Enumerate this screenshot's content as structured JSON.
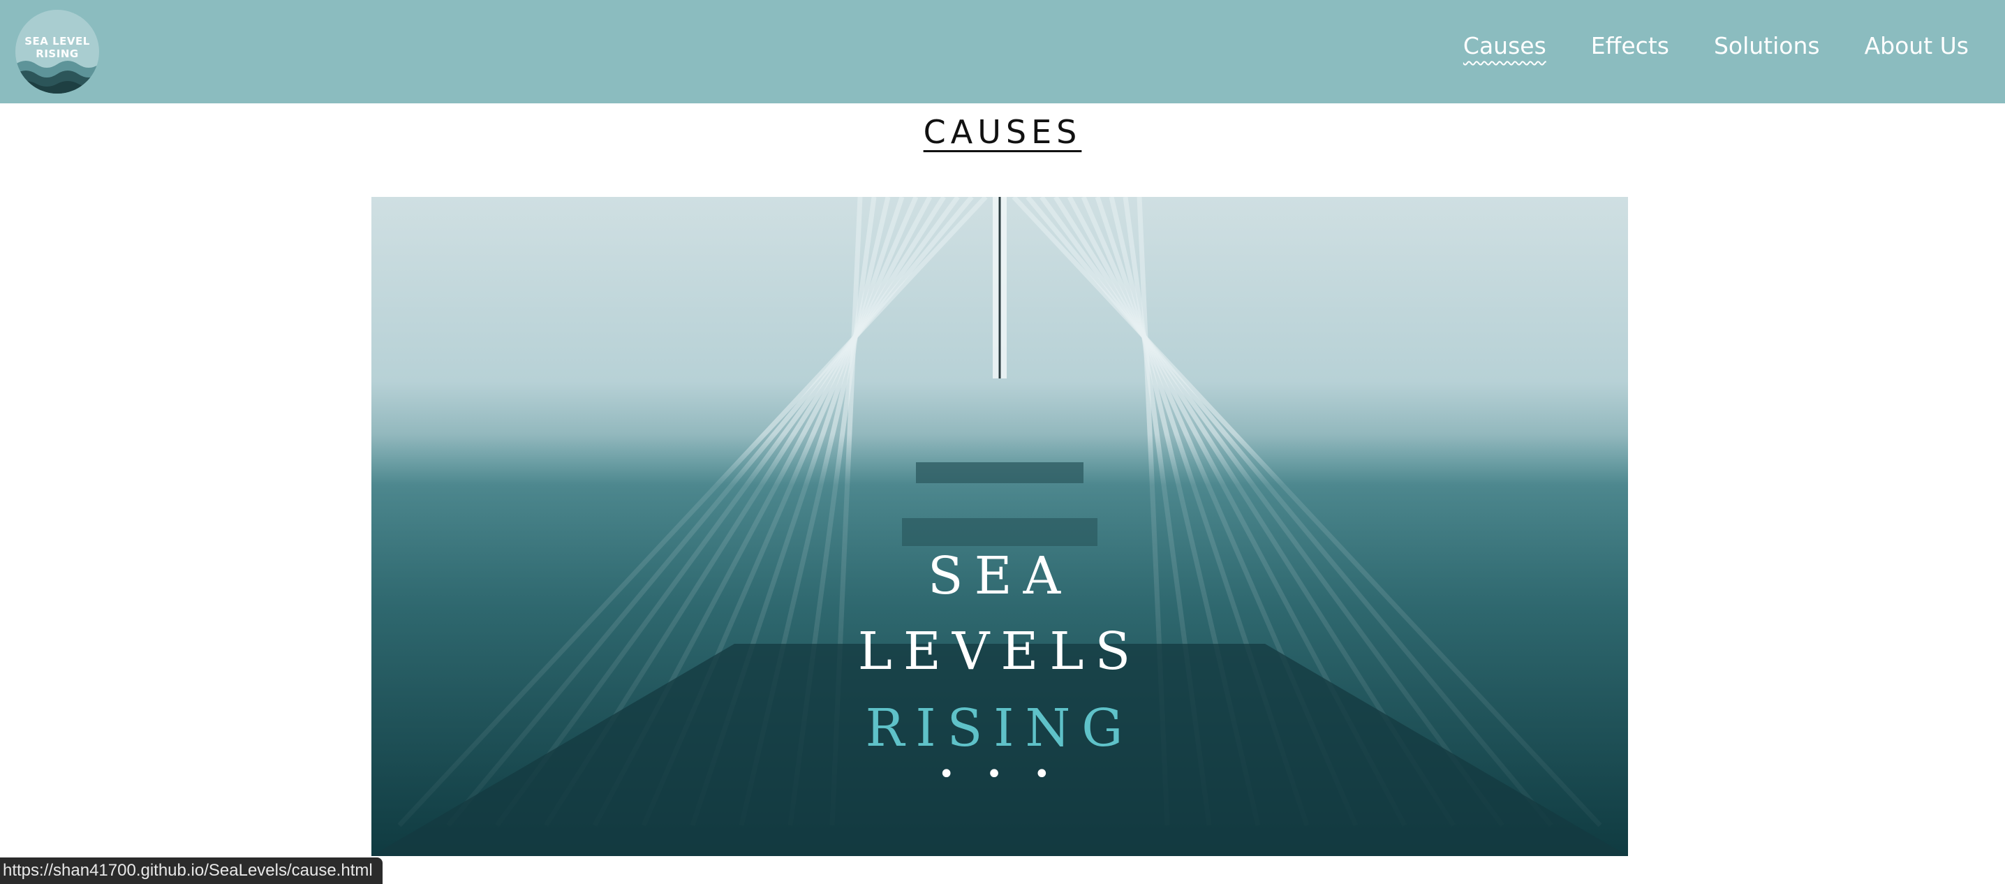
{
  "logo": {
    "text": "SEA LEVEL\nRISING",
    "icon": "wave-logo-icon"
  },
  "nav": {
    "items": [
      {
        "label": "Causes",
        "active": true
      },
      {
        "label": "Effects",
        "active": false
      },
      {
        "label": "Solutions",
        "active": false
      },
      {
        "label": "About Us",
        "active": false
      }
    ]
  },
  "page": {
    "title": "CAUSES"
  },
  "hero": {
    "line1": "SEA",
    "line2": "LEVELS",
    "line3": "RISING",
    "dots": "• • •"
  },
  "status_bar": {
    "url": "https://shan41700.github.io/SeaLevels/cause.html"
  },
  "colors": {
    "navbar": "#8bbcbf",
    "accent": "#5fc2c9"
  }
}
